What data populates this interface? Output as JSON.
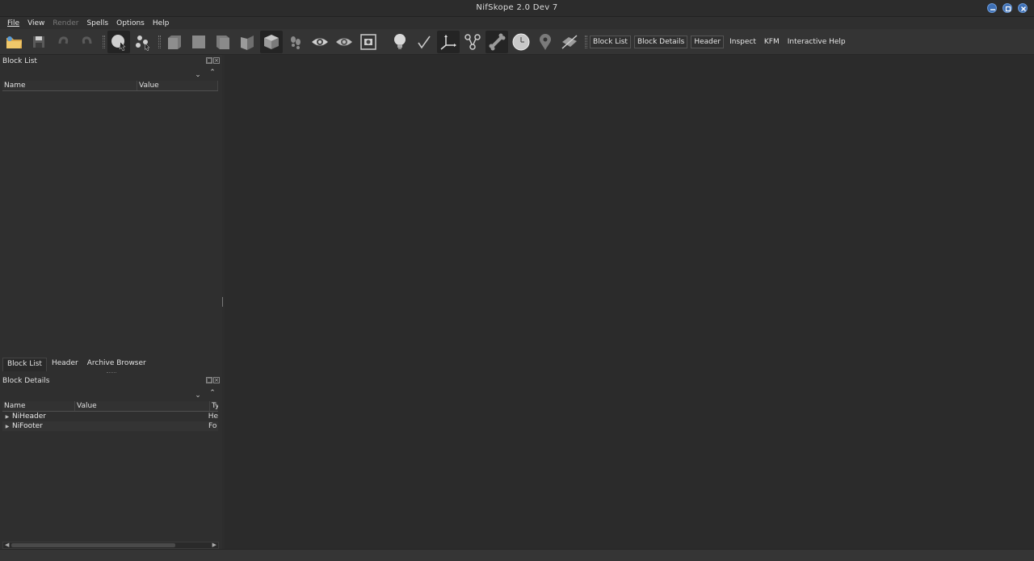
{
  "window": {
    "title": "NifSkope 2.0 Dev 7"
  },
  "window_buttons": [
    {
      "icon": "minimize-icon"
    },
    {
      "icon": "maximize-icon"
    },
    {
      "icon": "close-icon"
    }
  ],
  "menubar": {
    "items": [
      {
        "label": "File",
        "enabled": true
      },
      {
        "label": "View",
        "enabled": true
      },
      {
        "label": "Render",
        "enabled": false
      },
      {
        "label": "Spells",
        "enabled": true
      },
      {
        "label": "Options",
        "enabled": true
      },
      {
        "label": "Help",
        "enabled": true
      }
    ]
  },
  "toolbar": {
    "icons": [
      "open-folder-icon",
      "save-icon",
      "undo-icon",
      "redo-icon",
      "select-sphere-icon",
      "select-nodes-icon",
      "view-front-icon",
      "view-side-icon",
      "view-top-icon",
      "view-walk-icon",
      "view-user-icon",
      "footsteps-icon",
      "eye-icon",
      "eye-outline-icon",
      "screenshot-icon",
      "lightbulb-icon",
      "normals-icon",
      "axes-icon",
      "nodes-tree-icon",
      "bone-icon",
      "clock-icon",
      "marker-icon",
      "lock-icon"
    ],
    "text_buttons": [
      {
        "label": "Block List",
        "boxed": true
      },
      {
        "label": "Block Details",
        "boxed": true
      },
      {
        "label": "Header",
        "boxed": true
      },
      {
        "label": "Inspect",
        "boxed": false
      },
      {
        "label": "KFM",
        "boxed": false
      },
      {
        "label": "Interactive Help",
        "boxed": false
      }
    ]
  },
  "block_list": {
    "title": "Block List",
    "columns": [
      "Name",
      "Value"
    ]
  },
  "left_tabs": [
    {
      "label": "Block List",
      "selected": true
    },
    {
      "label": "Header",
      "selected": false
    },
    {
      "label": "Archive Browser",
      "selected": false
    }
  ],
  "block_details": {
    "title": "Block Details",
    "columns": [
      "Name",
      "Value",
      "Ty"
    ],
    "rows": [
      {
        "name": "NiHeader",
        "type": "He"
      },
      {
        "name": "NiFooter",
        "type": "Fo"
      }
    ]
  }
}
